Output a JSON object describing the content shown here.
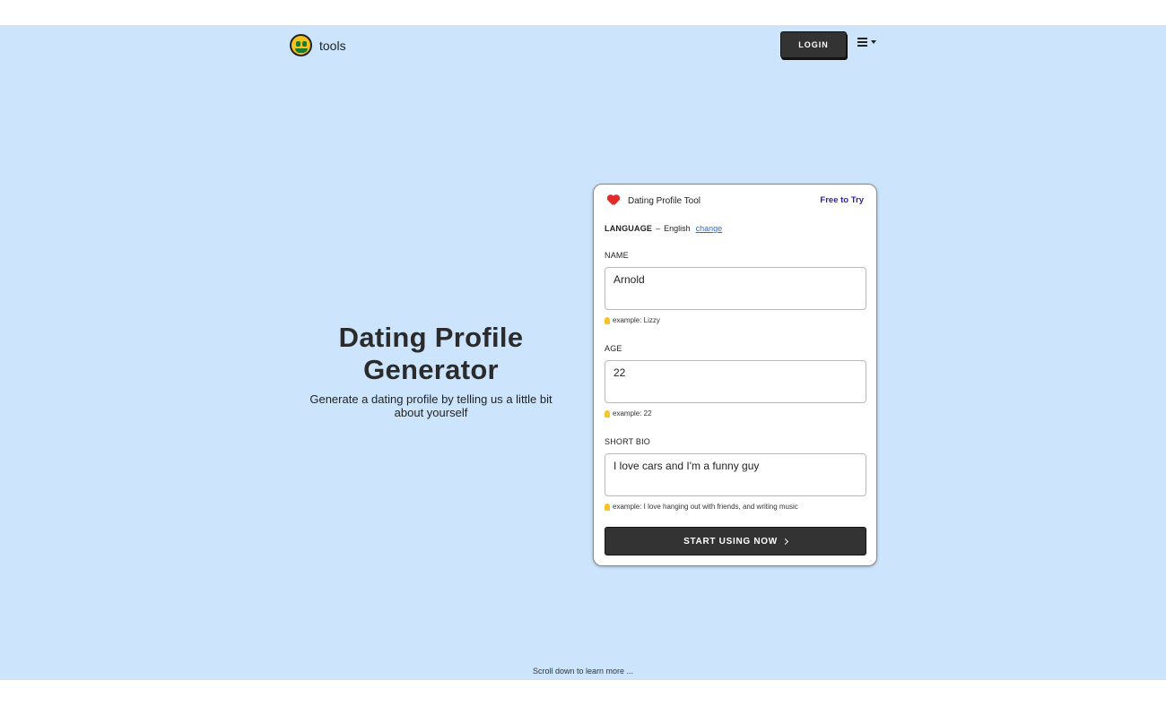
{
  "nav": {
    "logo_text": "tools",
    "login_label": "LOGIN"
  },
  "hero": {
    "title": "Dating Profile Generator",
    "subtitle": "Generate a dating profile by telling us a little bit about yourself"
  },
  "card": {
    "title": "Dating Profile Tool",
    "badge": "Free to Try",
    "language_key": "LANGUAGE",
    "language_sep": "–",
    "language_value": "English",
    "language_change": "change",
    "fields": [
      {
        "label": "NAME",
        "value": "Arnold",
        "hint": "example: Lizzy"
      },
      {
        "label": "AGE",
        "value": "22",
        "hint": "example: 22"
      },
      {
        "label": "SHORT BIO",
        "value": "I love cars and I'm a funny guy",
        "hint": "example: I love hanging out with friends, and writing music"
      }
    ],
    "submit_label": "START USING NOW"
  },
  "footer": {
    "scroll_hint": "Scroll down to learn more ..."
  },
  "colors": {
    "hero_bg": "#cce5fd",
    "button_bg": "#333333",
    "badge": "#2a1fb5",
    "link": "#1f6fd6",
    "heart": "#e22a2a"
  },
  "icons": [
    "money-face-icon",
    "hamburger-menu-icon",
    "heart-icon",
    "lightbulb-icon",
    "chevron-right-icon"
  ]
}
